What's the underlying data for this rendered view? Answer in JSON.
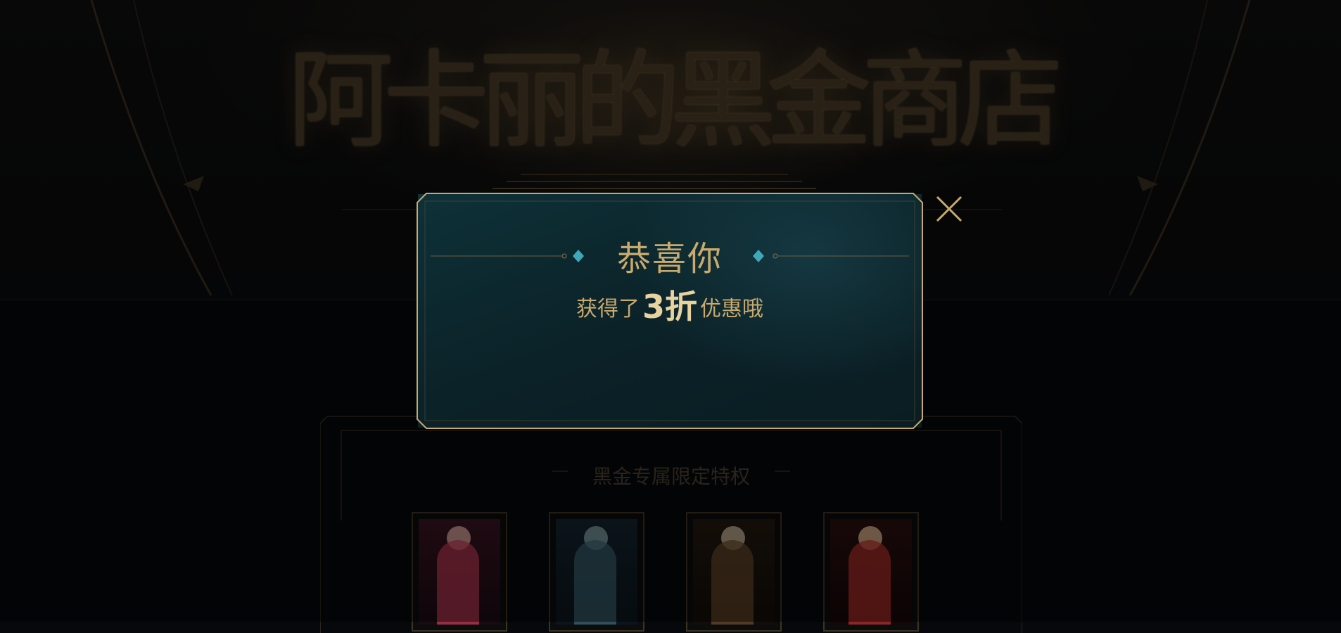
{
  "hero": {
    "title": "阿卡丽的黑金商店"
  },
  "section": {
    "title": "黑金专属限定特权",
    "cards": [
      {
        "name": "skin-card-1",
        "colors": [
          "#3a1422",
          "#c23b55",
          "#e8b3a8"
        ]
      },
      {
        "name": "skin-card-2",
        "colors": [
          "#142530",
          "#3d6472",
          "#8aa7ad"
        ]
      },
      {
        "name": "skin-card-3",
        "colors": [
          "#23190f",
          "#6b4a2e",
          "#d4c2a4"
        ]
      },
      {
        "name": "skin-card-4",
        "colors": [
          "#2b0f10",
          "#b5322e",
          "#efc39a"
        ]
      }
    ]
  },
  "dialog": {
    "heading": "恭喜你",
    "sub_prefix": "获得了",
    "sub_value": "3折",
    "sub_suffix": "优惠哦"
  },
  "icons": {
    "close": "close-icon",
    "diamond": "diamond-icon"
  },
  "colors": {
    "gold": "#c8aa6e",
    "teal": "#0e3138",
    "accent_diamond": "#3fa7b8"
  }
}
